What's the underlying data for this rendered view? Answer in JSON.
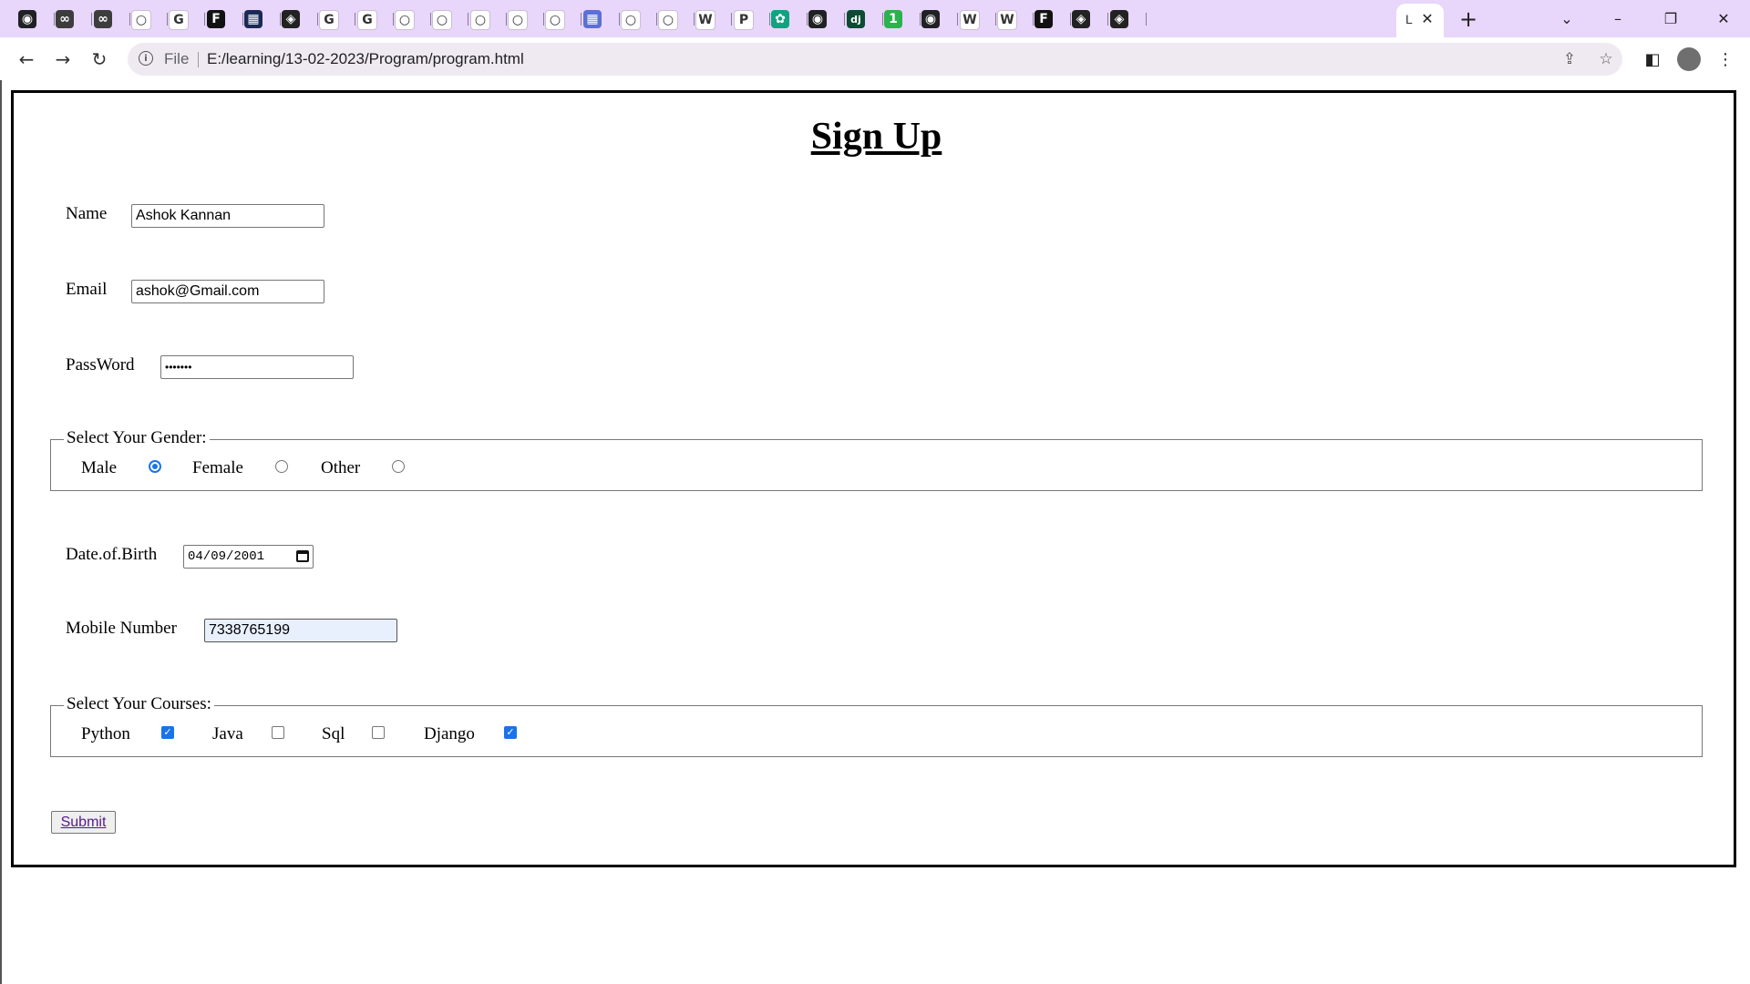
{
  "browser": {
    "active_tab_letter": "L",
    "tab_favicons": [
      {
        "icon": "globe-icon",
        "color": "#202124",
        "glyph": "◉"
      },
      {
        "icon": "infinity-icon",
        "color": "#3d3d3d",
        "glyph": "∞"
      },
      {
        "icon": "infinity-icon",
        "color": "#3d3d3d",
        "glyph": "∞"
      },
      {
        "icon": "github-icon",
        "color": "#ffffff",
        "glyph": "○"
      },
      {
        "icon": "google-icon",
        "color": "#ffffff",
        "glyph": "G"
      },
      {
        "icon": "f-icon",
        "color": "#111111",
        "glyph": "F"
      },
      {
        "icon": "dark-app-icon",
        "color": "#1b2a55",
        "glyph": "▦"
      },
      {
        "icon": "codepen-icon",
        "color": "#222222",
        "glyph": "◈"
      },
      {
        "icon": "google-icon",
        "color": "#ffffff",
        "glyph": "G"
      },
      {
        "icon": "google-icon",
        "color": "#ffffff",
        "glyph": "G"
      },
      {
        "icon": "github-icon",
        "color": "#ffffff",
        "glyph": "○"
      },
      {
        "icon": "github-icon",
        "color": "#ffffff",
        "glyph": "○"
      },
      {
        "icon": "github-icon",
        "color": "#ffffff",
        "glyph": "○"
      },
      {
        "icon": "github-icon",
        "color": "#ffffff",
        "glyph": "○"
      },
      {
        "icon": "github-icon",
        "color": "#ffffff",
        "glyph": "○"
      },
      {
        "icon": "grid-icon",
        "color": "#5b6fd6",
        "glyph": "▦"
      },
      {
        "icon": "github-icon",
        "color": "#ffffff",
        "glyph": "○"
      },
      {
        "icon": "github-icon",
        "color": "#ffffff",
        "glyph": "○"
      },
      {
        "icon": "w-icon",
        "color": "#ffffff",
        "glyph": "W"
      },
      {
        "icon": "p-icon",
        "color": "#ffffff",
        "glyph": "P"
      },
      {
        "icon": "openai-icon",
        "color": "#10a37f",
        "glyph": "✿"
      },
      {
        "icon": "globe-icon",
        "color": "#202124",
        "glyph": "◉"
      },
      {
        "icon": "django-icon",
        "color": "#0c4b33",
        "glyph": "dj"
      },
      {
        "icon": "one-icon",
        "color": "#2bb24c",
        "glyph": "1"
      },
      {
        "icon": "globe-icon",
        "color": "#202124",
        "glyph": "◉"
      },
      {
        "icon": "w-icon",
        "color": "#ffffff",
        "glyph": "W"
      },
      {
        "icon": "w-icon",
        "color": "#ffffff",
        "glyph": "W"
      },
      {
        "icon": "f-icon",
        "color": "#111111",
        "glyph": "F"
      },
      {
        "icon": "codepen-icon",
        "color": "#222222",
        "glyph": "◈"
      },
      {
        "icon": "codepen-icon",
        "color": "#222222",
        "glyph": "◈"
      }
    ],
    "omnibox": {
      "scheme_label": "File",
      "url": "E:/learning/13-02-2023/Program/program.html"
    },
    "colors": {
      "tabstrip": "#e8d6fb",
      "omnibox": "#efeaf1",
      "accent": "#1a73e8"
    }
  },
  "form": {
    "title": "Sign Up",
    "name": {
      "label": "Name",
      "value": "Ashok Kannan"
    },
    "email": {
      "label": "Email",
      "value": "ashok@Gmail.com"
    },
    "password": {
      "label": "PassWord",
      "masked_value": "•••••••"
    },
    "gender": {
      "legend": "Select Your Gender:",
      "options": [
        {
          "label": "Male",
          "selected": true
        },
        {
          "label": "Female",
          "selected": false
        },
        {
          "label": "Other",
          "selected": false
        }
      ]
    },
    "dob": {
      "label": "Date.of.Birth",
      "value": "04/09/2001"
    },
    "mobile": {
      "label": "Mobile Number",
      "value": "7338765199"
    },
    "courses": {
      "legend": "Select Your Courses:",
      "options": [
        {
          "label": "Python",
          "checked": true
        },
        {
          "label": "Java",
          "checked": false
        },
        {
          "label": "Sql",
          "checked": false
        },
        {
          "label": "Django",
          "checked": true
        }
      ]
    },
    "submit_label": "Submit"
  }
}
